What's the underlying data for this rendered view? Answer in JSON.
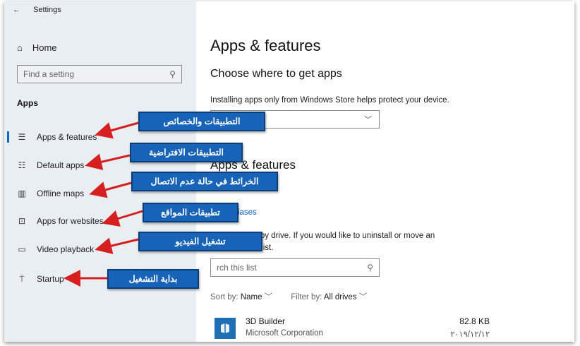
{
  "window": {
    "title": "Settings"
  },
  "sidebar": {
    "home_label": "Home",
    "search_placeholder": "Find a setting",
    "section_label": "Apps",
    "items": [
      {
        "label": "Apps & features",
        "icon": "list-icon"
      },
      {
        "label": "Default apps",
        "icon": "default-apps-icon"
      },
      {
        "label": "Offline maps",
        "icon": "map-icon"
      },
      {
        "label": "Apps for websites",
        "icon": "web-app-icon"
      },
      {
        "label": "Video playback",
        "icon": "video-icon"
      },
      {
        "label": "Startup",
        "icon": "startup-icon"
      }
    ]
  },
  "main": {
    "title": "Apps & features",
    "choose_heading": "Choose where to get apps",
    "store_note": "Installing apps only from Windows Store helps protect your device.",
    "apps_heading": "Apps & features",
    "alias_link": "aliases",
    "filter_text_1": "nd filter by drive. If you would like to uninstall or move an",
    "filter_text_2": "rom the list.",
    "list_search_placeholder": "rch this list",
    "sort_label": "Sort by:",
    "sort_value": "Name",
    "filter_label": "Filter by:",
    "filter_value": "All drives",
    "app": {
      "name": "3D Builder",
      "publisher": "Microsoft Corporation",
      "size": "82.8 KB",
      "date": "٢٠١٩/١٢/١٢"
    }
  },
  "annotations": [
    "التطبيقات والخصائص",
    "التطبيقات الافتراضية",
    "الخرائط في حالة عدم الاتصال",
    "تطبيقات المواقع",
    "تشغيل الفيديو",
    "بداية التشغيل"
  ],
  "colors": {
    "accent": "#0a69c2",
    "callout": "#1763b8",
    "arrow": "#d62020",
    "sidebar_bg": "#e8eef1"
  }
}
